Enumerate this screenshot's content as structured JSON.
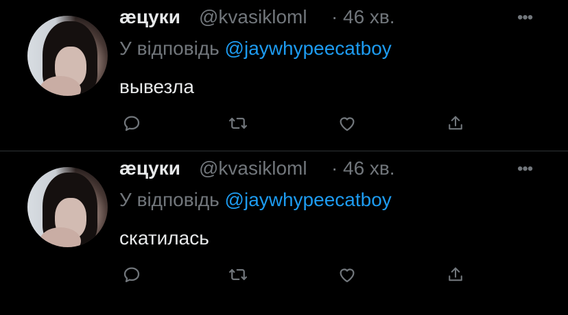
{
  "colors": {
    "background": "#000000",
    "divider": "#2f3336",
    "text_primary": "#e7e9ea",
    "text_secondary": "#71767b",
    "link": "#1d9bf0"
  },
  "tweets": [
    {
      "author_name": "æцуки",
      "handle": "@kvasikloml",
      "separator": "·",
      "time": "46 хв.",
      "more_label": "•••",
      "reply_prefix": "У відповідь ",
      "reply_to": "@jaywhypeecatboy",
      "text": "вывезла",
      "actions": [
        "reply-icon",
        "retweet-icon",
        "like-icon",
        "share-icon"
      ]
    },
    {
      "author_name": "æцуки",
      "handle": "@kvasikloml",
      "separator": "·",
      "time": "46 хв.",
      "more_label": "•••",
      "reply_prefix": "У відповідь ",
      "reply_to": "@jaywhypeecatboy",
      "text": "скатилась",
      "actions": [
        "reply-icon",
        "retweet-icon",
        "like-icon",
        "share-icon"
      ]
    }
  ]
}
